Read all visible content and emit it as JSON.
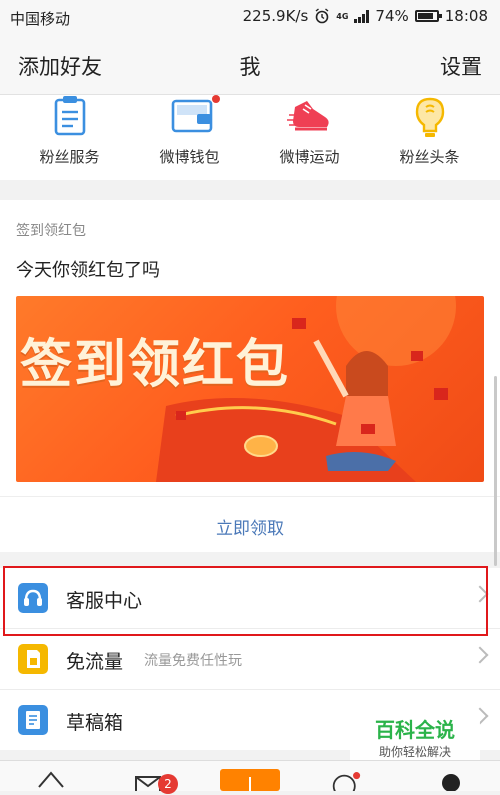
{
  "status": {
    "carrier": "中国移动",
    "speed": "225.9K/s",
    "network": "4G",
    "battery": "74%",
    "time": "18:08"
  },
  "nav": {
    "left": "添加好友",
    "title": "我",
    "right": "设置"
  },
  "shortcuts": [
    {
      "label": "粉丝服务",
      "icon": "clipboard-icon",
      "color": "#3b8fe0"
    },
    {
      "label": "微博钱包",
      "icon": "wallet-icon",
      "color": "#3b8fe0",
      "dot": true
    },
    {
      "label": "微博运动",
      "icon": "sneaker-icon",
      "color": "#ef3f54"
    },
    {
      "label": "粉丝头条",
      "icon": "lightbulb-icon",
      "color": "#f5b800"
    }
  ],
  "checkin": {
    "subtitle": "签到领红包",
    "title": "今天你领红包了吗",
    "banner_text": "签到领红包",
    "cta": "立即领取"
  },
  "menu": [
    {
      "label": "客服中心",
      "sublabel": "",
      "icon": "headset-icon",
      "color": "#3b8fe0"
    },
    {
      "label": "免流量",
      "sublabel": "流量免费任性玩",
      "icon": "sim-card-icon",
      "color": "#f5b800"
    },
    {
      "label": "草稿箱",
      "sublabel": "",
      "icon": "draft-icon",
      "color": "#3b8fe0"
    }
  ],
  "tabbar": {
    "message_badge": "2",
    "accent": "#ff8200"
  },
  "watermark": {
    "line1": "百科全说",
    "line2": "助你轻松解决"
  }
}
